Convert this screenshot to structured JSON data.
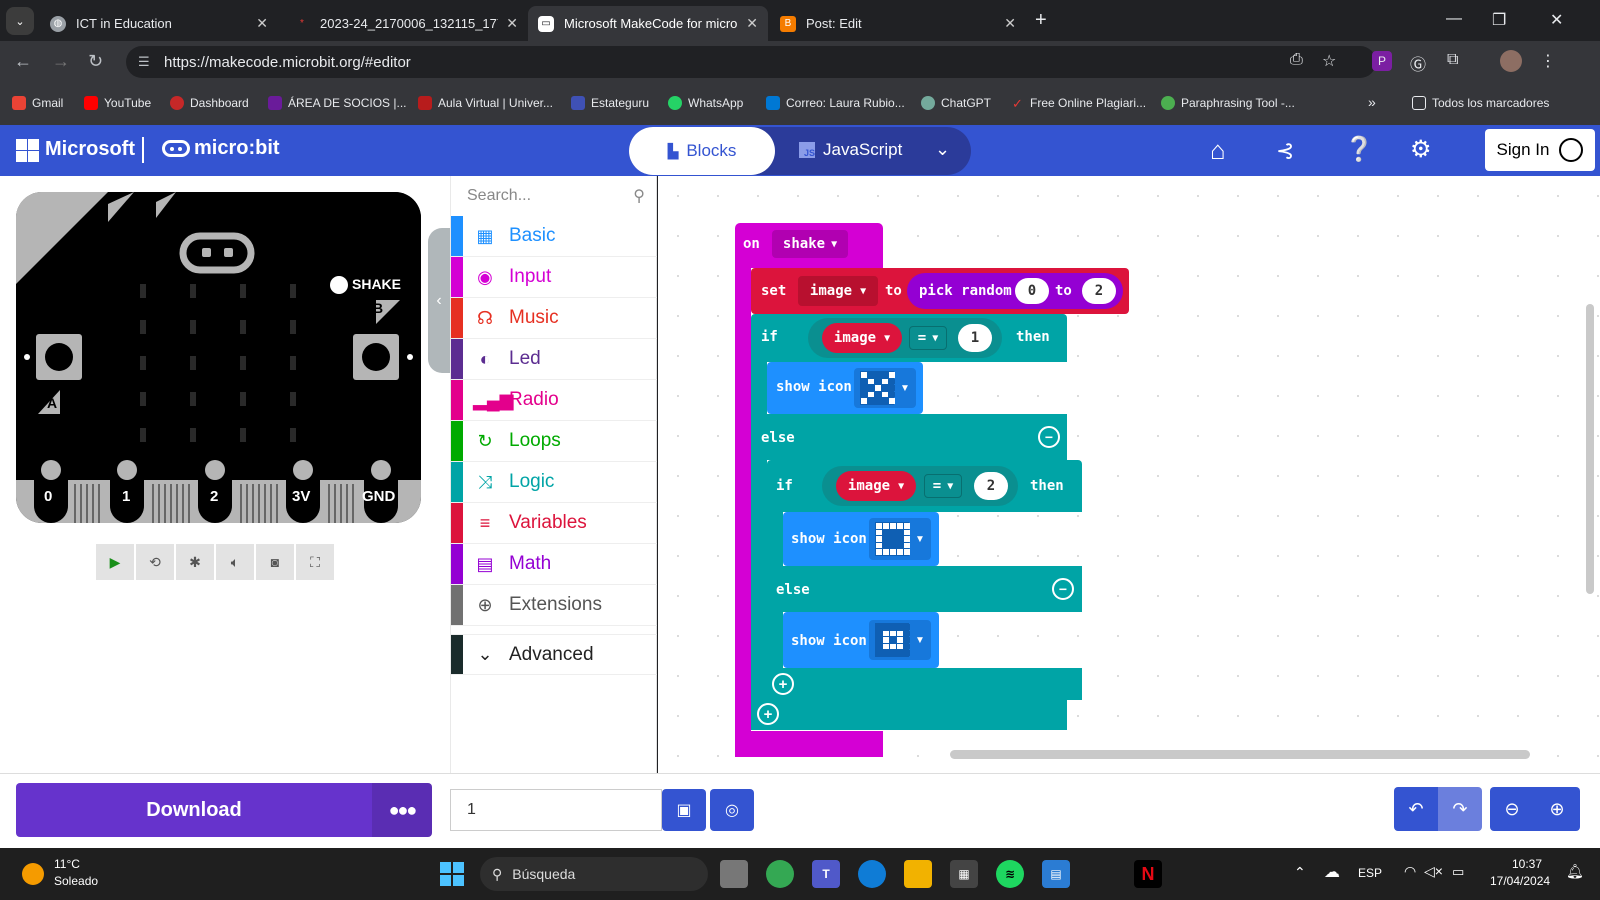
{
  "browser": {
    "tabs": [
      {
        "title": "ICT in Education",
        "active": false
      },
      {
        "title": "2023-24_2170006_132115_1772",
        "active": false
      },
      {
        "title": "Microsoft MakeCode for micro:",
        "active": true
      },
      {
        "title": "Post: Edit",
        "active": false
      }
    ],
    "url": "https://makecode.microbit.org/#editor",
    "bookmarks": [
      "Gmail",
      "YouTube",
      "Dashboard",
      "ÁREA DE SOCIOS |...",
      "Aula Virtual | Univer...",
      "Estateguru",
      "WhatsApp",
      "Correo: Laura Rubio...",
      "ChatGPT",
      "Free Online Plagiari...",
      "Paraphrasing Tool -..."
    ],
    "all_bookmarks": "Todos los marcadores",
    "more": "»"
  },
  "header": {
    "ms_label": "Microsoft",
    "brand": "micro:bit",
    "mode_blocks": "Blocks",
    "mode_js": "JavaScript",
    "js_badge": "JS",
    "sign_in": "Sign In"
  },
  "simulator": {
    "shake": "SHAKE",
    "btn_a": "A",
    "btn_b": "B",
    "pins": [
      "0",
      "1",
      "2",
      "3V",
      "GND"
    ]
  },
  "toolbox": {
    "search_placeholder": "Search...",
    "categories": [
      {
        "label": "Basic",
        "color": "#1e90ff"
      },
      {
        "label": "Input",
        "color": "#d400d4"
      },
      {
        "label": "Music",
        "color": "#e63022"
      },
      {
        "label": "Led",
        "color": "#5c2d91"
      },
      {
        "label": "Radio",
        "color": "#e3008c"
      },
      {
        "label": "Loops",
        "color": "#00aa00"
      },
      {
        "label": "Logic",
        "color": "#00a4a6"
      },
      {
        "label": "Variables",
        "color": "#dc143c"
      },
      {
        "label": "Math",
        "color": "#9400d3"
      },
      {
        "label": "Extensions",
        "color": "#717171"
      }
    ],
    "advanced": "Advanced"
  },
  "blocks": {
    "on": "on",
    "shake": "shake",
    "set": "set",
    "image": "image",
    "to": "to",
    "pick_random": "pick random",
    "zero": "0",
    "two": "2",
    "one": "1",
    "if": "if",
    "eq": "=",
    "then": "then",
    "else": "else",
    "show_icon": "show icon"
  },
  "footer": {
    "download": "Download",
    "more": "●●●",
    "project_name": "1"
  },
  "taskbar": {
    "temp": "11°C",
    "weather": "Soleado",
    "search": "Búsqueda",
    "lang": "ESP",
    "time": "10:37",
    "date": "17/04/2024"
  },
  "colors": {
    "makecode_blue": "#3454d1",
    "download_purple": "#6633cc",
    "input_magenta": "#d400d4",
    "logic_teal": "#00a4a6",
    "variables_red": "#dc143c",
    "math_purple": "#9400d3",
    "basic_blue": "#1e90ff"
  }
}
